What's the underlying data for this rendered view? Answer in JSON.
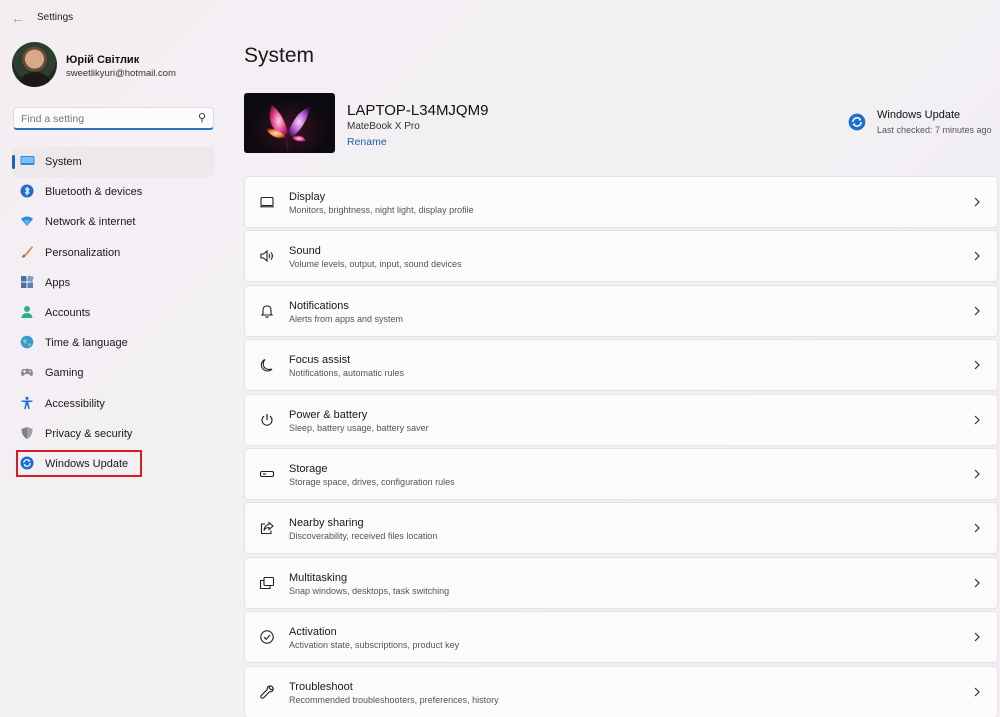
{
  "window": {
    "title": "Settings"
  },
  "profile": {
    "name": "Юрій Світлик",
    "email": "sweetlikyuri@hotmail.com"
  },
  "search": {
    "placeholder": "Find a setting"
  },
  "sidebar": {
    "items": [
      {
        "label": "System",
        "icon": "system-icon",
        "selected": true
      },
      {
        "label": "Bluetooth & devices",
        "icon": "bluetooth-icon"
      },
      {
        "label": "Network & internet",
        "icon": "wifi-icon"
      },
      {
        "label": "Personalization",
        "icon": "brush-icon"
      },
      {
        "label": "Apps",
        "icon": "apps-icon"
      },
      {
        "label": "Accounts",
        "icon": "person-icon"
      },
      {
        "label": "Time & language",
        "icon": "globe-icon"
      },
      {
        "label": "Gaming",
        "icon": "gamepad-icon"
      },
      {
        "label": "Accessibility",
        "icon": "accessibility-icon"
      },
      {
        "label": "Privacy & security",
        "icon": "shield-icon"
      },
      {
        "label": "Windows Update",
        "icon": "update-icon"
      }
    ]
  },
  "main": {
    "title": "System",
    "device": {
      "name": "LAPTOP-L34MJQM9",
      "model": "MateBook X Pro",
      "rename_label": "Rename"
    },
    "windows_update": {
      "title": "Windows Update",
      "status": "Last checked: 7 minutes ago"
    },
    "cards": [
      {
        "title": "Display",
        "subtitle": "Monitors, brightness, night light, display profile",
        "icon": "display-icon"
      },
      {
        "title": "Sound",
        "subtitle": "Volume levels, output, input, sound devices",
        "icon": "speaker-icon"
      },
      {
        "title": "Notifications",
        "subtitle": "Alerts from apps and system",
        "icon": "bell-icon"
      },
      {
        "title": "Focus assist",
        "subtitle": "Notifications, automatic rules",
        "icon": "moon-icon"
      },
      {
        "title": "Power & battery",
        "subtitle": "Sleep, battery usage, battery saver",
        "icon": "power-icon"
      },
      {
        "title": "Storage",
        "subtitle": "Storage space, drives, configuration rules",
        "icon": "storage-icon"
      },
      {
        "title": "Nearby sharing",
        "subtitle": "Discoverability, received files location",
        "icon": "share-icon"
      },
      {
        "title": "Multitasking",
        "subtitle": "Snap windows, desktops, task switching",
        "icon": "multitasking-icon"
      },
      {
        "title": "Activation",
        "subtitle": "Activation state, subscriptions, product key",
        "icon": "check-circle-icon"
      },
      {
        "title": "Troubleshoot",
        "subtitle": "Recommended troubleshooters, preferences, history",
        "icon": "wrench-icon"
      }
    ]
  },
  "colors": {
    "accent": "#1a65c2",
    "highlight_box": "#d41f26",
    "link": "#1f5fa8"
  }
}
